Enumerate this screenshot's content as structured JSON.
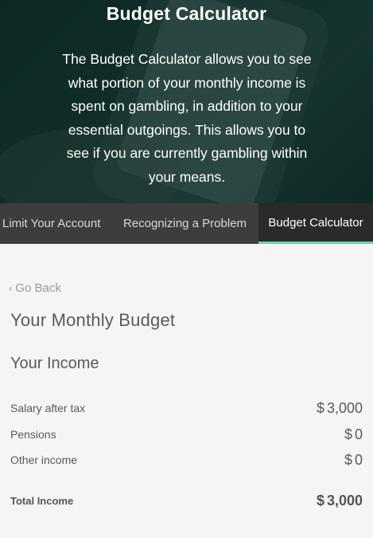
{
  "hero": {
    "title": "Budget Calculator",
    "description": "The Budget Calculator allows you to see what portion of your monthly income is spent on gambling, in addition to your essential outgoings. This allows you to see if you are currently gambling within your means."
  },
  "tabs": [
    {
      "label": "Limit Your Account",
      "active": false
    },
    {
      "label": "Recognizing a Problem",
      "active": false
    },
    {
      "label": "Budget Calculator",
      "active": true
    }
  ],
  "nav": {
    "back_label": "Go Back",
    "back_icon": "chevron-left-icon"
  },
  "budget": {
    "title": "Your Monthly Budget",
    "income": {
      "title": "Your Income",
      "currency": "$",
      "rows": [
        {
          "label": "Salary after tax",
          "value": "3,000"
        },
        {
          "label": "Pensions",
          "value": "0"
        },
        {
          "label": "Other income",
          "value": "0"
        }
      ],
      "total": {
        "label": "Total Income",
        "value": "3,000"
      }
    }
  },
  "colors": {
    "hero_bg": "#14332f",
    "tab_bar": "#3e3d3d",
    "tab_active": "#2a2a2a",
    "accent": "#6cd1a7",
    "page_bg": "#f5f5f5"
  }
}
